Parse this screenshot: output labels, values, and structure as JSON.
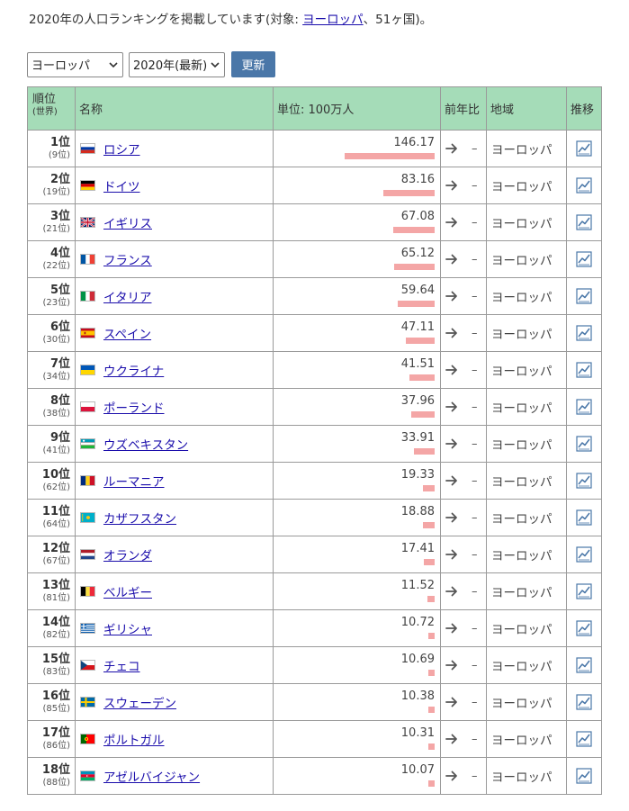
{
  "intro": {
    "prefix": "2020年の人口ランキングを掲載しています(対象: ",
    "link": "ヨーロッパ",
    "suffix": "、51ヶ国)。"
  },
  "controls": {
    "region_select": "ヨーロッパ",
    "year_select": "2020年(最新)",
    "update_button": "更新"
  },
  "headers": {
    "rank": "順位",
    "rank_sub": "(世界)",
    "name": "名称",
    "population": "単位: 100万人",
    "change": "前年比",
    "region": "地域",
    "trend": "推移"
  },
  "colors": {
    "header_bg": "#a5dcb8",
    "bar": "#f4a6a6",
    "button": "#4a77a8",
    "link": "#1a0dab"
  },
  "max_value": 146.17,
  "rows": [
    {
      "rank": "1位",
      "world": "(9位)",
      "name": "ロシア",
      "value": "146.17",
      "change": "–",
      "region": "ヨーロッパ",
      "flag": "russia"
    },
    {
      "rank": "2位",
      "world": "(19位)",
      "name": "ドイツ",
      "value": "83.16",
      "change": "–",
      "region": "ヨーロッパ",
      "flag": "germany"
    },
    {
      "rank": "3位",
      "world": "(21位)",
      "name": "イギリス",
      "value": "67.08",
      "change": "–",
      "region": "ヨーロッパ",
      "flag": "uk"
    },
    {
      "rank": "4位",
      "world": "(22位)",
      "name": "フランス",
      "value": "65.12",
      "change": "–",
      "region": "ヨーロッパ",
      "flag": "france"
    },
    {
      "rank": "5位",
      "world": "(23位)",
      "name": "イタリア",
      "value": "59.64",
      "change": "–",
      "region": "ヨーロッパ",
      "flag": "italy"
    },
    {
      "rank": "6位",
      "world": "(30位)",
      "name": "スペイン",
      "value": "47.11",
      "change": "–",
      "region": "ヨーロッパ",
      "flag": "spain"
    },
    {
      "rank": "7位",
      "world": "(34位)",
      "name": "ウクライナ",
      "value": "41.51",
      "change": "–",
      "region": "ヨーロッパ",
      "flag": "ukraine"
    },
    {
      "rank": "8位",
      "world": "(38位)",
      "name": "ポーランド",
      "value": "37.96",
      "change": "–",
      "region": "ヨーロッパ",
      "flag": "poland"
    },
    {
      "rank": "9位",
      "world": "(41位)",
      "name": "ウズベキスタン",
      "value": "33.91",
      "change": "–",
      "region": "ヨーロッパ",
      "flag": "uzbekistan"
    },
    {
      "rank": "10位",
      "world": "(62位)",
      "name": "ルーマニア",
      "value": "19.33",
      "change": "–",
      "region": "ヨーロッパ",
      "flag": "romania"
    },
    {
      "rank": "11位",
      "world": "(64位)",
      "name": "カザフスタン",
      "value": "18.88",
      "change": "–",
      "region": "ヨーロッパ",
      "flag": "kazakhstan"
    },
    {
      "rank": "12位",
      "world": "(67位)",
      "name": "オランダ",
      "value": "17.41",
      "change": "–",
      "region": "ヨーロッパ",
      "flag": "netherlands"
    },
    {
      "rank": "13位",
      "world": "(81位)",
      "name": "ベルギー",
      "value": "11.52",
      "change": "–",
      "region": "ヨーロッパ",
      "flag": "belgium"
    },
    {
      "rank": "14位",
      "world": "(82位)",
      "name": "ギリシャ",
      "value": "10.72",
      "change": "–",
      "region": "ヨーロッパ",
      "flag": "greece"
    },
    {
      "rank": "15位",
      "world": "(83位)",
      "name": "チェコ",
      "value": "10.69",
      "change": "–",
      "region": "ヨーロッパ",
      "flag": "czech"
    },
    {
      "rank": "16位",
      "world": "(85位)",
      "name": "スウェーデン",
      "value": "10.38",
      "change": "–",
      "region": "ヨーロッパ",
      "flag": "sweden"
    },
    {
      "rank": "17位",
      "world": "(86位)",
      "name": "ポルトガル",
      "value": "10.31",
      "change": "–",
      "region": "ヨーロッパ",
      "flag": "portugal"
    },
    {
      "rank": "18位",
      "world": "(88位)",
      "name": "アゼルバイジャン",
      "value": "10.07",
      "change": "–",
      "region": "ヨーロッパ",
      "flag": "azerbaijan"
    }
  ]
}
